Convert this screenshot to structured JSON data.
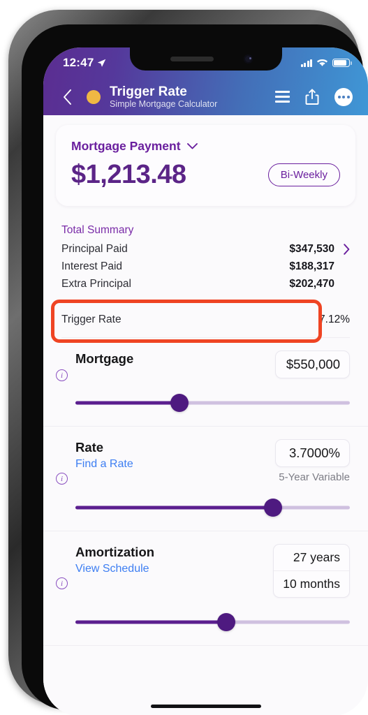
{
  "status_bar": {
    "time": "12:47",
    "location_icon": "location-arrow-icon",
    "signal_icon": "cellular-signal-icon",
    "wifi_icon": "wifi-icon",
    "battery_icon": "battery-icon"
  },
  "nav": {
    "back_icon": "back-chevron-icon",
    "status_dot": "amber-status-dot",
    "title": "Trigger Rate",
    "subtitle": "Simple Mortgage Calculator",
    "menu_icon": "hamburger-menu-icon",
    "share_icon": "share-icon",
    "more_icon": "more-options-icon"
  },
  "payment_card": {
    "label": "Mortgage Payment",
    "dropdown_icon": "chevron-down-icon",
    "amount": "$1,213.48",
    "frequency": "Bi-Weekly"
  },
  "summary": {
    "title": "Total Summary",
    "disclosure_icon": "chevron-right-icon",
    "rows": [
      {
        "label": "Principal Paid",
        "value": "$347,530",
        "has_chevron": true
      },
      {
        "label": "Interest Paid",
        "value": "$188,317",
        "has_chevron": false
      },
      {
        "label": "Extra Principal",
        "value": "$202,470",
        "has_chevron": false
      }
    ]
  },
  "trigger": {
    "label": "Trigger Rate",
    "value": "7.12%",
    "highlight_color": "#ef4423"
  },
  "mortgage": {
    "title": "Mortgage",
    "value": "$550,000",
    "info_icon": "info-icon",
    "slider_percent": 38
  },
  "rate": {
    "title": "Rate",
    "link": "Find a Rate",
    "value": "3.7000%",
    "note": "5-Year Variable",
    "info_icon": "info-icon",
    "slider_percent": 72
  },
  "amortization": {
    "title": "Amortization",
    "link": "View Schedule",
    "years": "27 years",
    "months": "10 months",
    "info_icon": "info-icon",
    "slider_percent": 55
  },
  "theme": {
    "purple": "#5b2487",
    "purple_light": "#7a2ca8",
    "blue_link": "#3d7ef2",
    "amber": "#f0b844",
    "orange_highlight": "#ef4423"
  }
}
